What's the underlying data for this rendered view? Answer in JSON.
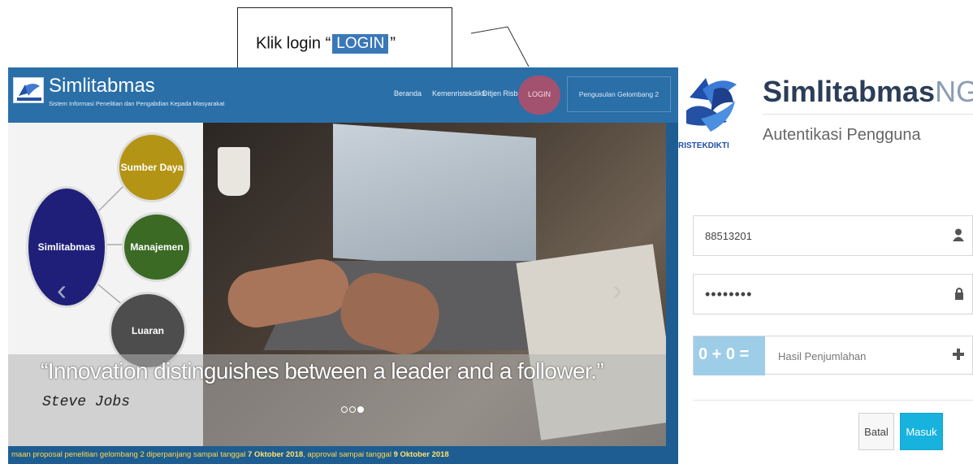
{
  "callout": {
    "text_before": "Klik login “",
    "chip": "LOGIN",
    "text_after": "”"
  },
  "site": {
    "brand": "Simlitabmas",
    "brand_sub": "Sistem Informasi Penelitian dan Pengabdian Kepada Masyarakat",
    "nav": [
      "Beranda",
      "Kemenristekdikti",
      "Ditjen Risbang"
    ],
    "login": "LOGIN",
    "nav_button": "Pengusulan Gelombang 2",
    "circles": {
      "main": "Simlitabmas",
      "sd": "Sumber Daya",
      "mj": "Manajemen",
      "lr": "Luaran"
    },
    "quote": "“Innovation distinguishes between a leader and a follower.”",
    "author": "Steve Jobs",
    "ticker_a": "maan proposal penelitian gelombang 2 diperpanjang sampai tanggal ",
    "ticker_b": "7 Oktober 2018",
    "ticker_c": ", approval sampai tanggal ",
    "ticker_d": "9 Oktober 2018",
    "colors": {
      "nav": "#2a6fa8",
      "login_pill": "#a2526f",
      "ticker": "#ffd84d"
    }
  },
  "auth": {
    "title_main": "Simlitabmas",
    "title_ng": "NG",
    "subtitle": "Autentikasi Pengguna",
    "logo_text": "RISTEKDIKTI",
    "username": "88513201",
    "password_mask": "••••••••",
    "captcha": "0 + 0 =",
    "captcha_placeholder": "Hasil Penjumlahan",
    "cancel": "Batal",
    "submit": "Masuk",
    "colors": {
      "primary": "#17b3de",
      "captcha": "#9ecde8"
    }
  }
}
